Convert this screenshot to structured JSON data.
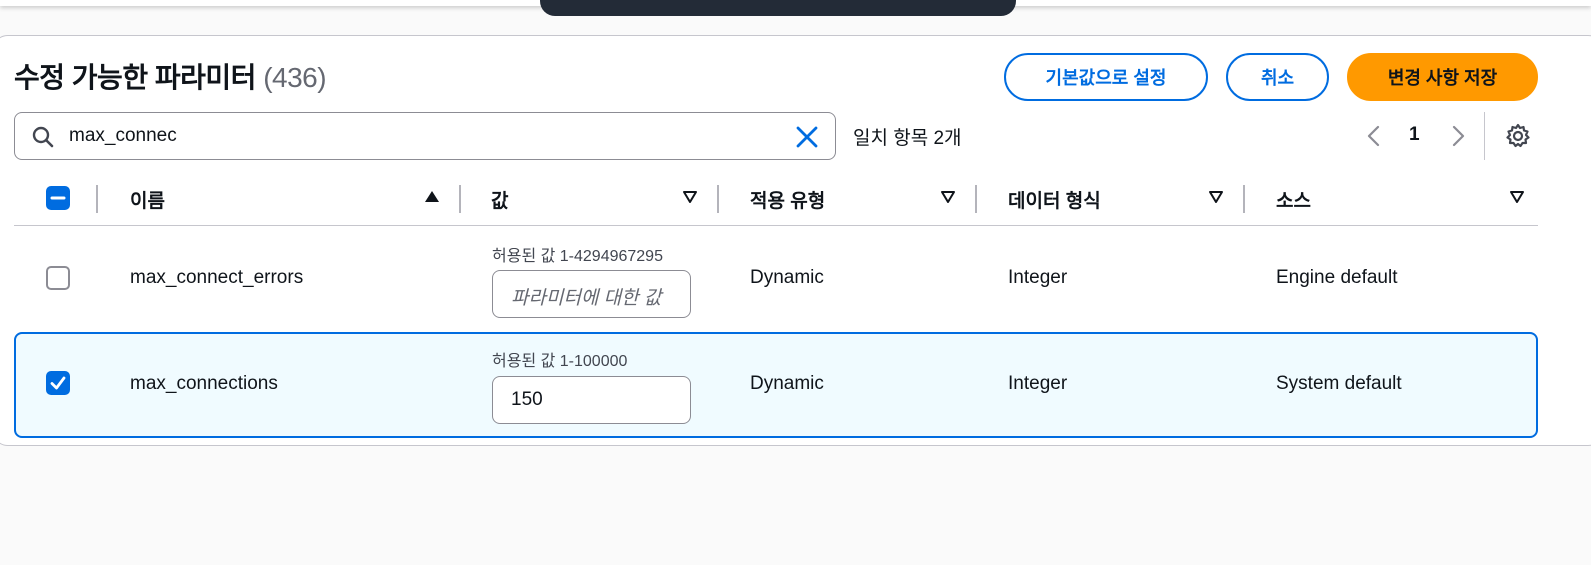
{
  "header": {
    "title": "수정 가능한 파라미터",
    "count": "(436)",
    "buttons": {
      "reset_label": "기본값으로 설정",
      "cancel_label": "취소",
      "save_label": "변경 사항 저장"
    }
  },
  "search": {
    "value": "max_connec",
    "icon": "search-icon",
    "clear_icon": "close-icon"
  },
  "match_text": "일치 항목 2개",
  "pagination": {
    "current_page": "1"
  },
  "table": {
    "columns": [
      {
        "label": "이름",
        "sort": "ascending"
      },
      {
        "label": "값",
        "sort": "none"
      },
      {
        "label": "적용 유형",
        "sort": "none"
      },
      {
        "label": "데이터 형식",
        "sort": "none"
      },
      {
        "label": "소스",
        "sort": "none"
      }
    ],
    "rows": [
      {
        "selected": false,
        "name": "max_connect_errors",
        "hint": "허용된 값 1-4294967295",
        "value": "",
        "placeholder": "파라미터에 대한 값",
        "apply_type": "Dynamic",
        "data_type": "Integer",
        "source": "Engine default"
      },
      {
        "selected": true,
        "name": "max_connections",
        "hint": "허용된 값 1-100000",
        "value": "150",
        "placeholder": "",
        "apply_type": "Dynamic",
        "data_type": "Integer",
        "source": "System default"
      }
    ]
  },
  "colors": {
    "accent": "#006ce0",
    "primary_button": "#ff9900",
    "selected_row_bg": "#f0fbff"
  }
}
